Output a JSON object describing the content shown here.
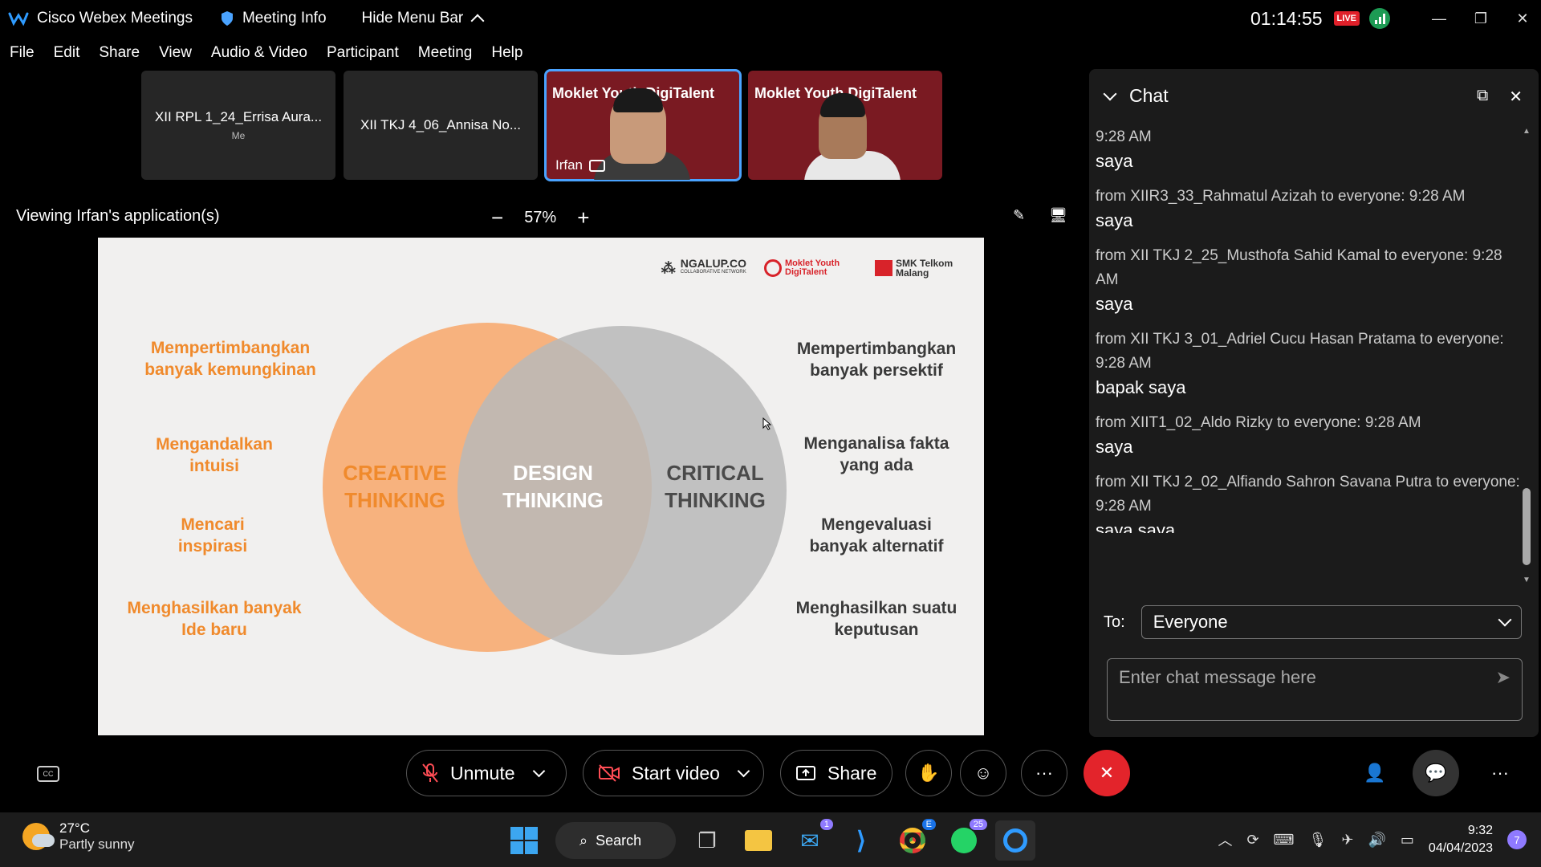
{
  "titlebar": {
    "app_name": "Cisco Webex Meetings",
    "meeting_info": "Meeting Info",
    "hide_menu_bar": "Hide Menu Bar",
    "clock": "01:14:55",
    "live_badge": "LIVE"
  },
  "menu": [
    "File",
    "Edit",
    "Share",
    "View",
    "Audio & Video",
    "Participant",
    "Meeting",
    "Help"
  ],
  "participants": [
    {
      "name": "XII RPL 1_24_Errisa Aura...",
      "sub": "Me"
    },
    {
      "name": "XII TKJ 4_06_Annisa No...",
      "sub": ""
    },
    {
      "name": "Irfan",
      "sub": ""
    },
    {
      "name": "",
      "sub": ""
    }
  ],
  "thumb_brand": "Moklet Youth DigiTalent",
  "viewing": "Viewing Irfan's application(s)",
  "zoom": {
    "minus": "−",
    "level": "57%",
    "plus": "+"
  },
  "slide": {
    "logos": [
      "NGALUP.CO",
      "COLLABORATIVE NETWORK",
      "Moklet Youth DigiTalent",
      "SMK Telkom Malang"
    ],
    "creative": "CREATIVE THINKING",
    "design": "DESIGN THINKING",
    "critical": "CRITICAL THINKING",
    "left_items": [
      "Mempertimbangkan banyak kemungkinan",
      "Mengandalkan intuisi",
      "Mencari inspirasi",
      "Menghasilkan banyak Ide baru"
    ],
    "right_items": [
      "Mempertimbangkan banyak persektif",
      "Menganalisa fakta yang ada",
      "Mengevaluasi banyak alternatif",
      "Menghasilkan suatu keputusan"
    ],
    "colors": {
      "creative": "#f7b27e",
      "critical": "#bcbcbc",
      "overlap": "#c8a08a",
      "creative_text": "#f08a2c",
      "text_dark": "#3a3a3a"
    }
  },
  "chat": {
    "title": "Chat",
    "messages": [
      {
        "meta": "9:28 AM",
        "body": "saya"
      },
      {
        "meta": "from XIIR3_33_Rahmatul Azizah to everyone:    9:28 AM",
        "body": "saya"
      },
      {
        "meta": "from XII TKJ 2_25_Musthofa Sahid Kamal to everyone:  9:28 AM",
        "body": "saya"
      },
      {
        "meta": "from XII TKJ 3_01_Adriel Cucu Hasan Pratama to everyone:    9:28 AM",
        "body": "bapak saya"
      },
      {
        "meta": "from XIIT1_02_Aldo Rizky to everyone:    9:28 AM",
        "body": "saya"
      },
      {
        "meta": "from XII TKJ 2_02_Alfiando Sahron Savana Putra to everyone:    9:28 AM",
        "body": "saya saya"
      }
    ],
    "to_label": "To:",
    "to_value": "Everyone",
    "input_placeholder": "Enter chat message here"
  },
  "controls": {
    "unmute": "Unmute",
    "start_video": "Start video",
    "share": "Share"
  },
  "taskbar": {
    "temp": "27°C",
    "weather": "Partly sunny",
    "search": "Search",
    "mail_badge": "1",
    "chrome_badge": "E",
    "whatsapp_badge": "25",
    "time": "9:32",
    "date": "04/04/2023",
    "notif_count": "7"
  }
}
